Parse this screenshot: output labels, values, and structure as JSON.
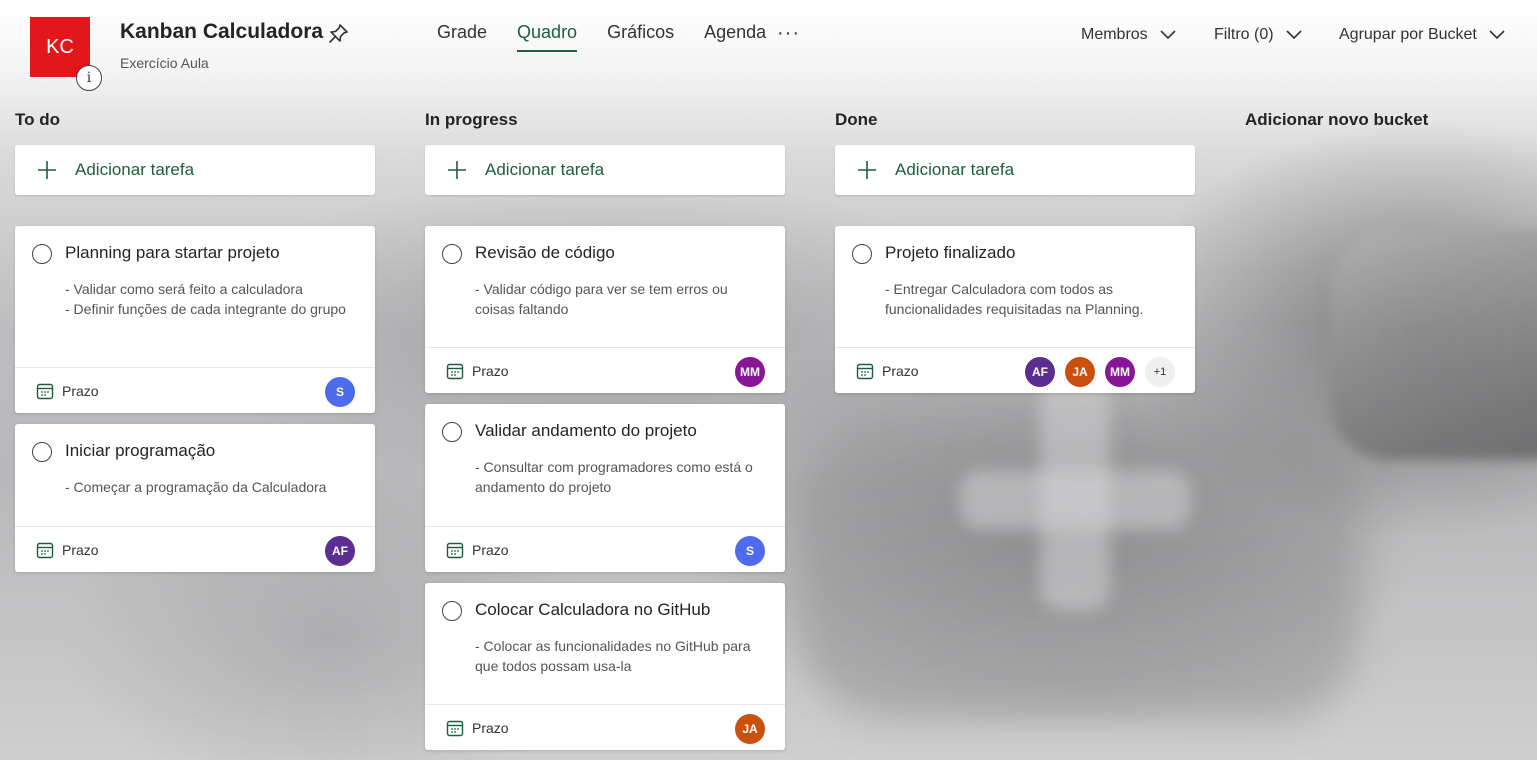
{
  "plan": {
    "initials": "KC",
    "info_glyph": "i",
    "title": "Kanban Calculadora",
    "subtitle": "Exercício Aula",
    "avatar_color": "#e3161c"
  },
  "nav": {
    "tabs": [
      {
        "label": "Grade",
        "active": false
      },
      {
        "label": "Quadro",
        "active": true
      },
      {
        "label": "Gráficos",
        "active": false
      },
      {
        "label": "Agenda",
        "active": false
      }
    ],
    "more_label": "···"
  },
  "toolbar": {
    "members_label": "Membros",
    "filter_label": "Filtro (0)",
    "group_label": "Agrupar por Bucket"
  },
  "buckets": [
    {
      "title": "To do",
      "add_label": "Adicionar tarefa"
    },
    {
      "title": "In progress",
      "add_label": "Adicionar tarefa"
    },
    {
      "title": "Done",
      "add_label": "Adicionar tarefa"
    }
  ],
  "new_bucket_label": "Adicionar novo bucket",
  "tasks": [
    {
      "bucket": 0,
      "title": "Planning para startar projeto",
      "desc": "- Validar como será feito a calculadora\n- Definir funções de cada integrante do grupo",
      "due_label": "Prazo",
      "assignees": [
        "S"
      ]
    },
    {
      "bucket": 0,
      "title": "Iniciar programação",
      "desc": "- Começar a programação da Calculadora",
      "due_label": "Prazo",
      "assignees": [
        "AF"
      ]
    },
    {
      "bucket": 1,
      "title": "Revisão de código",
      "desc": "- Validar código para ver se tem erros ou coisas faltando",
      "due_label": "Prazo",
      "assignees": [
        "MM"
      ]
    },
    {
      "bucket": 1,
      "title": "Validar andamento do projeto",
      "desc": "- Consultar com programadores como está o andamento do projeto",
      "due_label": "Prazo",
      "assignees": [
        "S"
      ]
    },
    {
      "bucket": 1,
      "title": "Colocar Calculadora no GitHub",
      "desc": "- Colocar as funcionalidades no GitHub para que todos possam usa-la",
      "due_label": "Prazo",
      "assignees": [
        "JA"
      ]
    },
    {
      "bucket": 2,
      "title": "Projeto finalizado",
      "desc": "- Entregar Calculadora com todos as funcionalidades requisitadas na Planning.",
      "due_label": "Prazo",
      "assignees": [
        "AF",
        "JA",
        "MM"
      ],
      "extra_assignees": "+1"
    }
  ],
  "colors": {
    "accent": "#1b5e3a",
    "avatar_S": "#4f6bed",
    "avatar_AF": "#5c2e91",
    "avatar_MM": "#881798",
    "avatar_JA": "#ca5010"
  },
  "icons": {
    "pin": "pin-icon",
    "calendar": "calendar-icon",
    "plus": "plus-icon",
    "chevron": "chevron-down-icon",
    "radio": "circle-checkbox-icon"
  }
}
